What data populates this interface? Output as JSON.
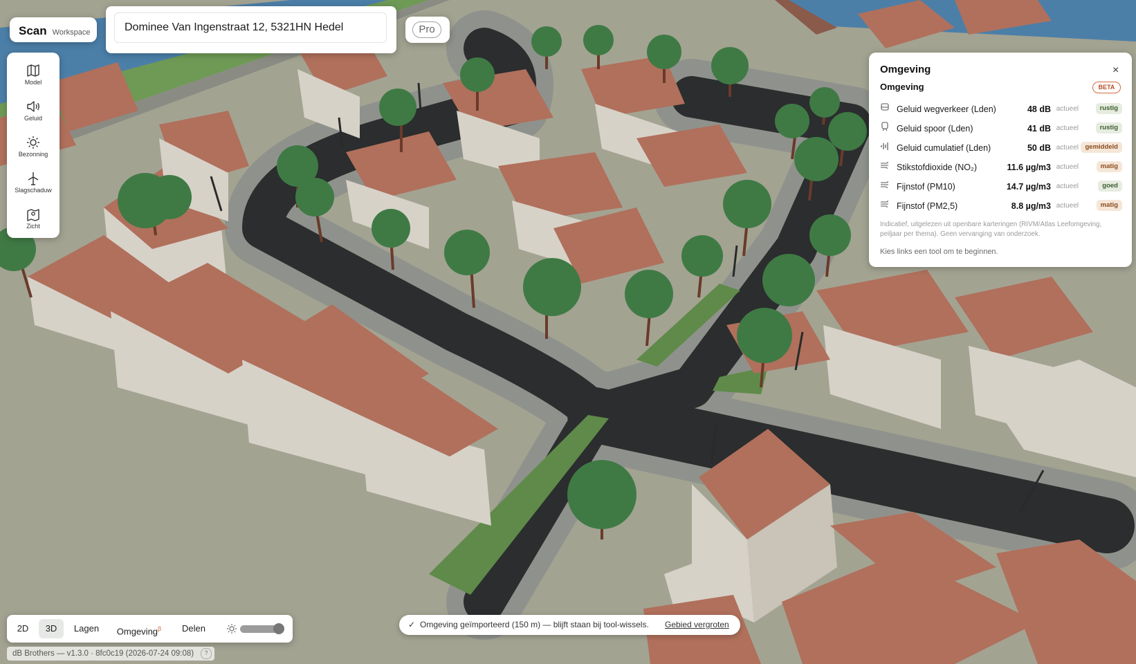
{
  "brand": {
    "name": "Scan",
    "sub": "Workspace"
  },
  "search": {
    "address": "Dominee Van Ingenstraat 12, 5321HN Hedel"
  },
  "pro": {
    "label": "Pro"
  },
  "tools": [
    {
      "label": "Model",
      "icon": "map-icon"
    },
    {
      "label": "Geluid",
      "icon": "speaker-icon"
    },
    {
      "label": "Bezonning",
      "icon": "sun-icon"
    },
    {
      "label": "Slagschaduw",
      "icon": "wind-turbine-icon"
    },
    {
      "label": "Zicht",
      "icon": "map-pin-icon"
    }
  ],
  "omgeving": {
    "title": "Omgeving",
    "close": "×",
    "subtitle": "Omgeving",
    "beta": "BETA",
    "rows": [
      {
        "label": "Geluid wegverkeer (Lden)",
        "value": "48 dB",
        "qualifier": "actueel",
        "status": "rustig",
        "icon": "car-icon"
      },
      {
        "label": "Geluid spoor (Lden)",
        "value": "41 dB",
        "qualifier": "actueel",
        "status": "rustig",
        "icon": "train-icon"
      },
      {
        "label": "Geluid cumulatief (Lden)",
        "value": "50 dB",
        "qualifier": "actueel",
        "status": "gemiddeld",
        "icon": "soundwave-icon"
      },
      {
        "label": "Stikstofdioxide (NO₂)",
        "value": "11.6 µg/m3",
        "qualifier": "actueel",
        "status": "matig",
        "icon": "wind-icon"
      },
      {
        "label": "Fijnstof (PM10)",
        "value": "14.7 µg/m3",
        "qualifier": "actueel",
        "status": "goed",
        "icon": "wind-icon"
      },
      {
        "label": "Fijnstof (PM2,5)",
        "value": "8.8 µg/m3",
        "qualifier": "actueel",
        "status": "matig",
        "icon": "wind-icon"
      }
    ],
    "note": "Indicatief, uitgelezen uit openbare karteringen (RIVM/Atlas Leefomgeving, peiljaar per thema). Geen vervanging van onderzoek.",
    "hint": "Kies links een tool om te beginnen."
  },
  "bottombar": {
    "view_2d": "2D",
    "view_3d": "3D",
    "layers": "Lagen",
    "omgeving": "Omgeving",
    "omgeving_mark": "β",
    "share": "Delen",
    "brightness_icon": "sun-icon"
  },
  "version": {
    "text": "dB Brothers — v1.3.0 · 8fc0c19 (2026-07-24 09:08)",
    "help": "?"
  },
  "toast": {
    "check": "✓",
    "message": "Omgeving geïmporteerd (150 m) — blijft staan bij tool-wissels.",
    "link": "Gebied vergroten"
  },
  "colors": {
    "road": "#2b2d2e",
    "sidewalk": "#8f928c",
    "ground": "#a3a392",
    "grass": "#5f8a4a",
    "roof": "#b0705c",
    "wall": "#d7d2c8",
    "tree": "#3f7a45",
    "water": "#4c7fa8",
    "accent": "#d4683f"
  }
}
